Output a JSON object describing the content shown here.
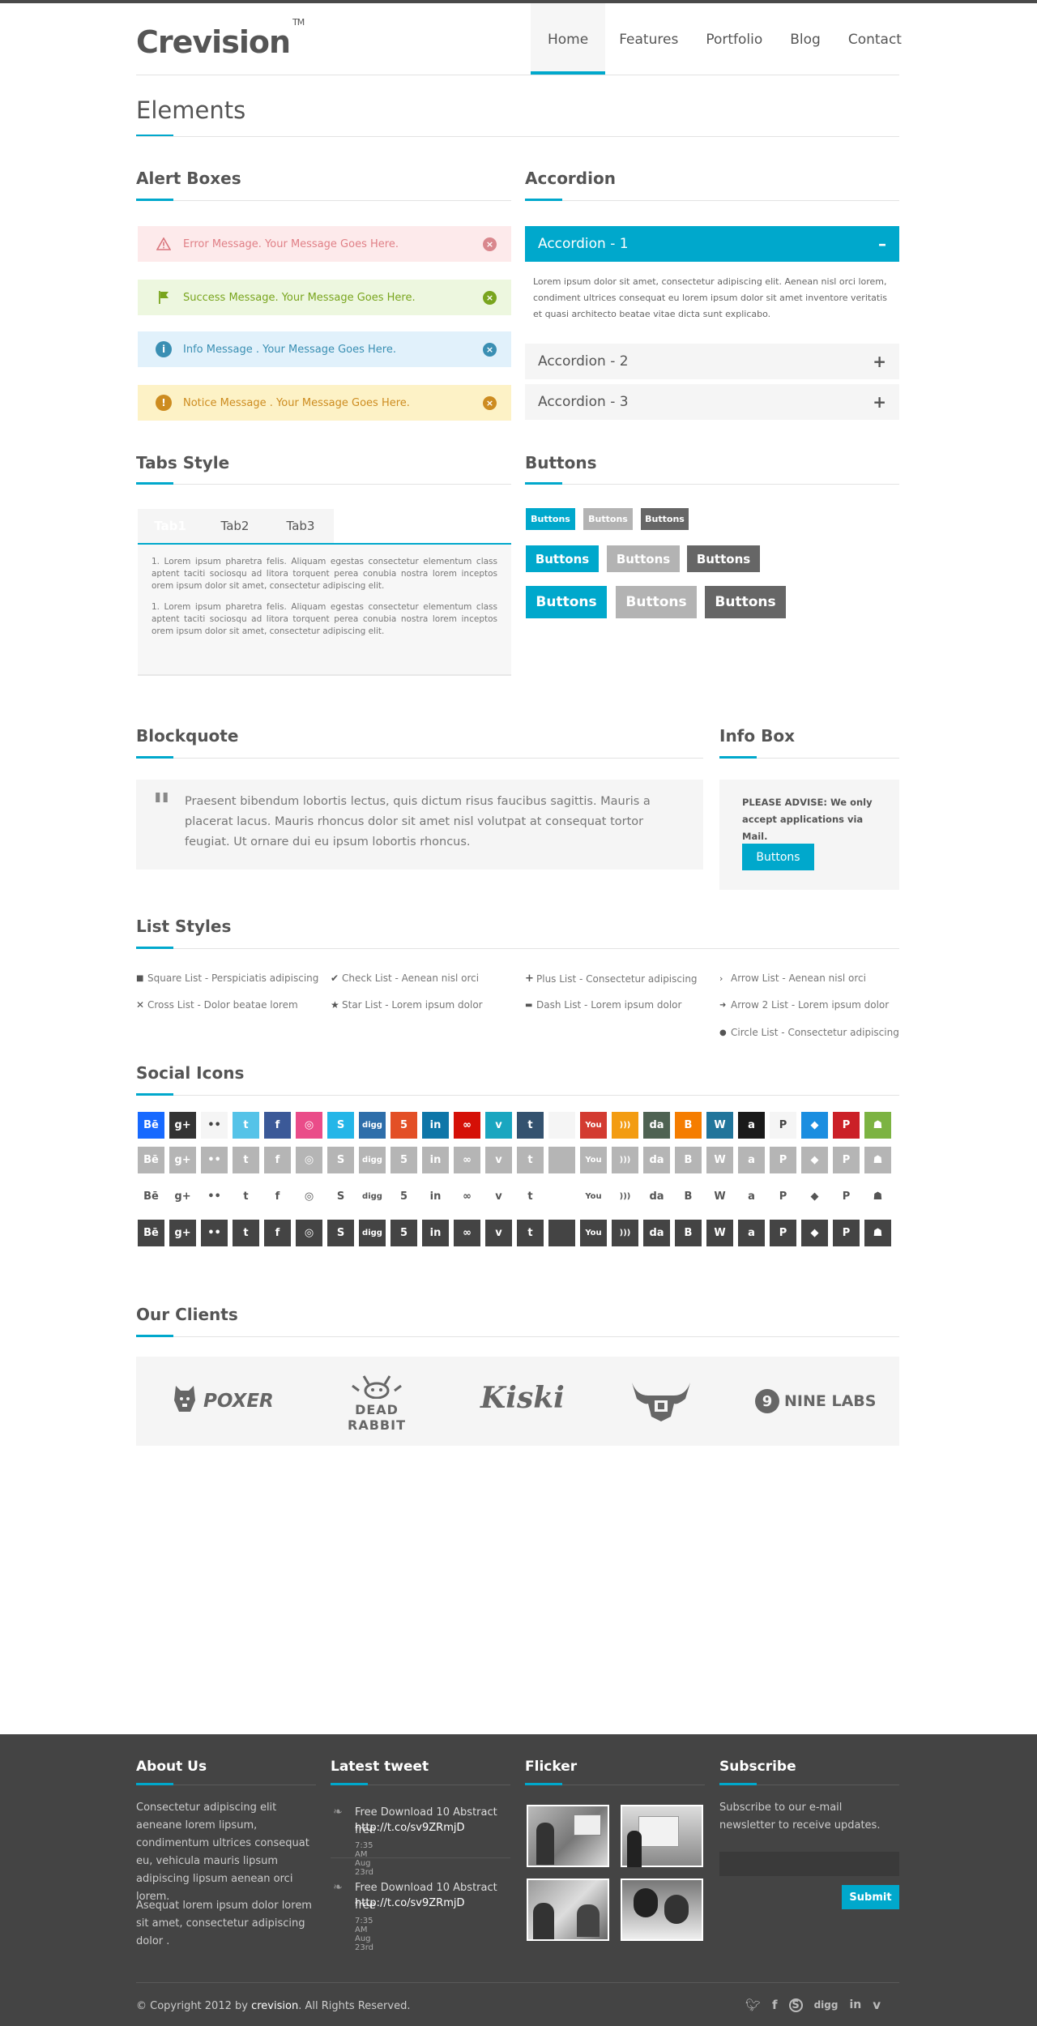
{
  "header": {
    "logo": "Crevision",
    "tm": "TM",
    "nav": [
      "Home",
      "Features",
      "Portfolio",
      "Blog",
      "Contact"
    ]
  },
  "page_title": "Elements",
  "alerts": {
    "title": "Alert Boxes",
    "items": [
      {
        "text": "Error Message. Your Message Goes Here.",
        "icon": "warning-icon",
        "color": "#e07f86",
        "bg": "#fdeaeb"
      },
      {
        "text": "Success Message. Your Message Goes Here.",
        "icon": "flag-icon",
        "color": "#79a51e",
        "bg": "#edf7df"
      },
      {
        "text": "Info Message . Your Message Goes Here.",
        "icon": "info-icon",
        "color": "#3a8fb3",
        "bg": "#e1f1fb"
      },
      {
        "text": "Notice Message . Your Message Goes Here.",
        "icon": "exclamation-icon",
        "color": "#cd8c20",
        "bg": "#fdf2c6"
      }
    ]
  },
  "accordion": {
    "title": "Accordion",
    "items": [
      "Accordion - 1",
      "Accordion - 2",
      "Accordion - 3"
    ],
    "body": "Lorem ipsum dolor sit amet, consectetur adipiscing elit. Aenean nisl orci lorem, condiment ultrices consequat eu lorem ipsum dolor sit amet inventore veritatis et quasi architecto beatae vitae dicta sunt explicabo.",
    "open_symbol": "–",
    "closed_symbol": "+"
  },
  "tabs": {
    "title": "Tabs Style",
    "items": [
      "Tab1",
      "Tab2",
      "Tab3"
    ],
    "para1": "1. Lorem ipsum pharetra felis. Aliquam egestas consectetur elementum class aptent taciti sociosqu ad litora torquent perea conubia nostra lorem inceptos orem ipsum dolor sit amet, consectetur adipiscing elit.",
    "para2": "1. Lorem ipsum pharetra felis. Aliquam egestas consectetur elementum class aptent taciti sociosqu ad litora torquent perea conubia nostra lorem inceptos orem ipsum dolor sit amet, consectetur adipiscing elit."
  },
  "buttons": {
    "title": "Buttons",
    "label": "Buttons"
  },
  "blockquote": {
    "title": "Blockquote",
    "text": "Praesent bibendum lobortis lectus, quis dictum risus faucibus sagittis. Mauris a placerat lacus. Mauris rhoncus dolor sit amet nisl volutpat at consequat tortor feugiat. Ut ornare dui eu ipsum lobortis rhoncus."
  },
  "infobox": {
    "title": "Info Box",
    "text": "PLEASE ADVISE: We only accept applications via Mail.",
    "button": "Buttons"
  },
  "lists": {
    "title": "List Styles",
    "col1": [
      "Square List - Perspiciatis adipiscing",
      "Cross List - Dolor beatae lorem"
    ],
    "col2": [
      "Check List - Aenean nisl orci",
      "Star List - Lorem ipsum dolor"
    ],
    "col3": [
      "Plus List - Consectetur adipiscing",
      "Dash List - Lorem ipsum dolor"
    ],
    "col4": [
      "Arrow List - Aenean nisl orci",
      "Arrow 2 List - Lorem ipsum dolor",
      "Circle List - Consectetur adipiscing"
    ]
  },
  "social": {
    "title": "Social Icons",
    "icons": [
      {
        "name": "behance",
        "glyph": "Bē",
        "color": "#1769ff"
      },
      {
        "name": "googleplus",
        "glyph": "g+",
        "color": "#333333"
      },
      {
        "name": "flickr",
        "glyph": "••",
        "color": "#f5f5f5"
      },
      {
        "name": "twitter",
        "glyph": "t",
        "color": "#55c3e8"
      },
      {
        "name": "facebook",
        "glyph": "f",
        "color": "#3b5998"
      },
      {
        "name": "dribbble",
        "glyph": "◎",
        "color": "#ea4c89"
      },
      {
        "name": "skype",
        "glyph": "S",
        "color": "#24b6e8"
      },
      {
        "name": "digg",
        "glyph": "digg",
        "color": "#2e6eaa"
      },
      {
        "name": "html5",
        "glyph": "5",
        "color": "#e34f26"
      },
      {
        "name": "linkedin",
        "glyph": "in",
        "color": "#0e76a8"
      },
      {
        "name": "lastfm",
        "glyph": "∞",
        "color": "#d51007"
      },
      {
        "name": "vimeo",
        "glyph": "v",
        "color": "#1aa6c0"
      },
      {
        "name": "tumblr",
        "glyph": "t",
        "color": "#34526f"
      },
      {
        "name": "apple",
        "glyph": "",
        "color": "#f5f5f5"
      },
      {
        "name": "youtube",
        "glyph": "You",
        "color": "#d33b31"
      },
      {
        "name": "rss",
        "glyph": ")))",
        "color": "#f39c12"
      },
      {
        "name": "deviantart",
        "glyph": "da",
        "color": "#4e6252"
      },
      {
        "name": "blogger",
        "glyph": "B",
        "color": "#f57d00"
      },
      {
        "name": "wordpress",
        "glyph": "W",
        "color": "#21759b"
      },
      {
        "name": "amazon",
        "glyph": "a",
        "color": "#1a1a1a"
      },
      {
        "name": "paypal",
        "glyph": "P",
        "color": "#f5f5f5"
      },
      {
        "name": "dropbox",
        "glyph": "◆",
        "color": "#1b8ee0"
      },
      {
        "name": "pinterest",
        "glyph": "P",
        "color": "#cb2027"
      },
      {
        "name": "android",
        "glyph": "☗",
        "color": "#7cb342"
      }
    ]
  },
  "clients": {
    "title": "Our Clients",
    "logos": [
      "POXER",
      "DEAD RABBIT",
      "Kiski",
      "",
      "NINE LABS"
    ]
  },
  "footer": {
    "about": {
      "title": "About Us",
      "p1": "Consectetur adipiscing elit aeneane lorem lipsum, condimentum ultrices consequat eu, vehicula mauris lipsum adipiscing lipsum aenean orci lorem.",
      "p2": "Asequat lorem ipsum dolor lorem sit amet, consectetur adipiscing dolor ."
    },
    "tweets": {
      "title": "Latest tweet",
      "items": [
        {
          "text": "Free Download 10 Abstract free",
          "link": "http://t.co/sv9ZRmjD",
          "time": "7:35 AM Aug 23rd"
        },
        {
          "text": "Free Download 10 Abstract free",
          "link": "http://t.co/sv9ZRmjD",
          "time": "7:35 AM Aug 23rd"
        }
      ]
    },
    "flicker": {
      "title": "Flicker"
    },
    "subscribe": {
      "title": "Subscribe",
      "text": "Subscribe to our e-mail newsletter to receive updates.",
      "button": "Submit",
      "placeholder": ""
    },
    "copyright_pre": "© Copyright 2012 by ",
    "copyright_brand": "crevision",
    "copyright_post": ". All Rights Reserved.",
    "social": [
      "twitter-icon",
      "facebook-icon",
      "skype-icon",
      "digg-icon",
      "linkedin-icon",
      "vimeo-icon"
    ]
  },
  "colors": {
    "accent": "#00a8cc",
    "dark": "#444444",
    "grey_button": "#b3b3b3",
    "dark_button": "#666666"
  }
}
